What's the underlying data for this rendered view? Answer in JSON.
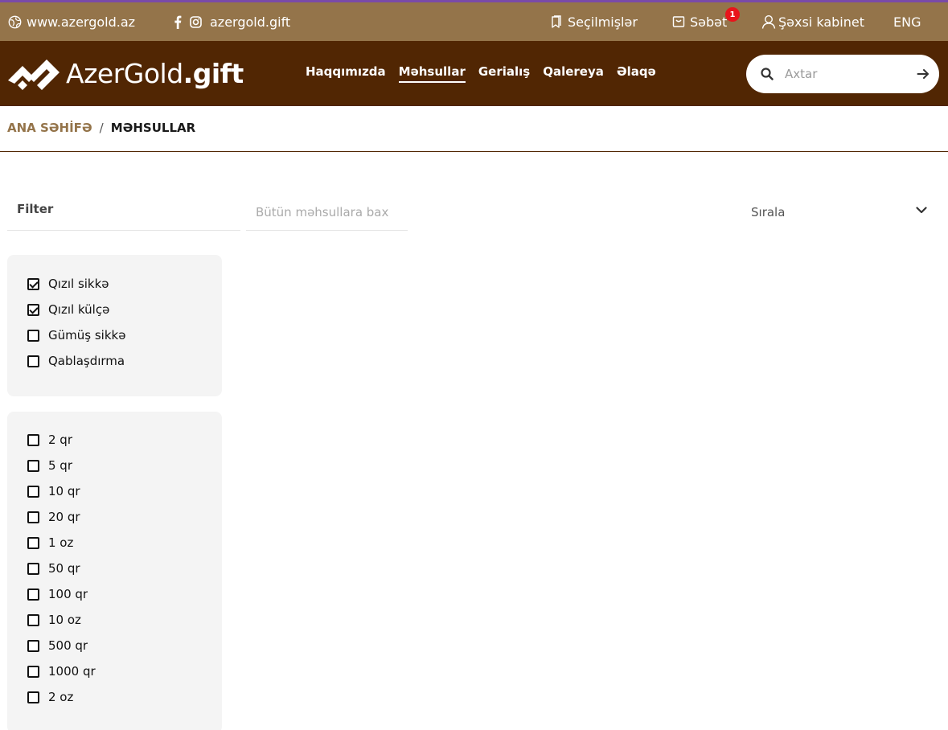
{
  "topbar": {
    "site_link": "www.azergold.az",
    "social_handle": "azergold.gift",
    "favorites": "Seçilmişlər",
    "cart": "Səbət",
    "cart_count": "1",
    "account": "Şəxsi kabinet",
    "language": "ENG",
    "icons": [
      "globe-icon",
      "facebook-icon",
      "instagram-icon",
      "bookmark-icon",
      "cart-icon",
      "user-icon"
    ],
    "background_color": "#94744a",
    "badge_color": "#e8141b"
  },
  "header": {
    "logo_text": "AzerGold",
    "logo_suffix": ".gift",
    "nav": [
      {
        "label": "Haqqımızda",
        "active": false
      },
      {
        "label": "Məhsullar",
        "active": true
      },
      {
        "label": "Gerialış",
        "active": false
      },
      {
        "label": "Qalereya",
        "active": false
      },
      {
        "label": "Əlaqə",
        "active": false
      }
    ],
    "search_placeholder": "Axtar",
    "background_color": "#512603"
  },
  "breadcrumb": {
    "home": "ANA SƏHİFƏ",
    "separator": "/",
    "current": "MƏHSULLAR"
  },
  "toolbar": {
    "filter_label": "Filter",
    "all_products": "Bütün məhsullara bax",
    "sort_label": "Sırala"
  },
  "filters": {
    "categories": [
      {
        "label": "Qızıl sikkə",
        "checked": true
      },
      {
        "label": "Qızıl külçə",
        "checked": true
      },
      {
        "label": "Gümüş sikkə",
        "checked": false
      },
      {
        "label": "Qablaşdırma",
        "checked": false
      }
    ],
    "weights": [
      {
        "label": "2 qr",
        "checked": false
      },
      {
        "label": "5 qr",
        "checked": false
      },
      {
        "label": "10 qr",
        "checked": false
      },
      {
        "label": "20 qr",
        "checked": false
      },
      {
        "label": "1 oz",
        "checked": false
      },
      {
        "label": "50 qr",
        "checked": false
      },
      {
        "label": "100 qr",
        "checked": false
      },
      {
        "label": "10 oz",
        "checked": false
      },
      {
        "label": "500 qr",
        "checked": false
      },
      {
        "label": "1000 qr",
        "checked": false
      },
      {
        "label": "2 oz",
        "checked": false
      }
    ]
  }
}
